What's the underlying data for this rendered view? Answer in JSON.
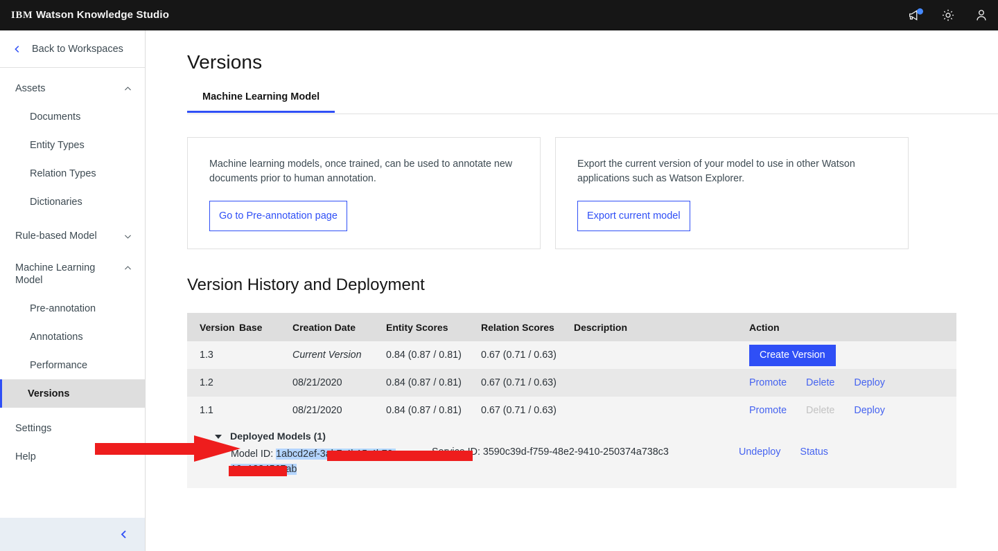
{
  "topbar": {
    "brand_ibm": "IBM",
    "brand_product": "Watson Knowledge Studio",
    "icons": [
      "announcement-icon",
      "gear-icon",
      "user-avatar-icon"
    ]
  },
  "sidebar": {
    "back_label": "Back to Workspaces",
    "groups": [
      {
        "label": "Assets",
        "expanded": true,
        "items": [
          "Documents",
          "Entity Types",
          "Relation Types",
          "Dictionaries"
        ]
      },
      {
        "label": "Rule-based Model",
        "expanded": false,
        "items": []
      },
      {
        "label": "Machine Learning Model",
        "expanded": true,
        "items": [
          "Pre-annotation",
          "Annotations",
          "Performance",
          "Versions"
        ]
      }
    ],
    "selected_item": "Versions",
    "flat_items": [
      "Settings",
      "Help"
    ],
    "collapse_label": "collapse-sidebar"
  },
  "main": {
    "title": "Versions",
    "tabs": [
      {
        "label": "Machine Learning Model",
        "active": true
      }
    ],
    "cards": [
      {
        "text": "Machine learning models, once trained, can be used to annotate new documents prior to human annotation.",
        "button": "Go to Pre-annotation page"
      },
      {
        "text": "Export the current version of your model to use in other Watson applications such as Watson Explorer.",
        "button": "Export current model"
      }
    ],
    "section_title": "Version History and Deployment",
    "table": {
      "columns": [
        "Version",
        "Base",
        "Creation Date",
        "Entity Scores",
        "Relation Scores",
        "Description",
        "Action"
      ],
      "rows": [
        {
          "version": "1.3",
          "base": "",
          "date": "Current Version",
          "date_italic": true,
          "entity": "0.84 (0.87 / 0.81)",
          "relation": "0.67 (0.71 / 0.63)",
          "description": "",
          "actions": [
            {
              "label": "Create Version",
              "type": "primary"
            }
          ]
        },
        {
          "version": "1.2",
          "base": "",
          "date": "08/21/2020",
          "date_italic": false,
          "entity": "0.84 (0.87 / 0.81)",
          "relation": "0.67 (0.71 / 0.63)",
          "description": "",
          "actions": [
            {
              "label": "Promote",
              "type": "link"
            },
            {
              "label": "Delete",
              "type": "link"
            },
            {
              "label": "Deploy",
              "type": "link"
            }
          ]
        },
        {
          "version": "1.1",
          "base": "",
          "date": "08/21/2020",
          "date_italic": false,
          "entity": "0.84 (0.87 / 0.81)",
          "relation": "0.67 (0.71 / 0.63)",
          "description": "",
          "actions": [
            {
              "label": "Promote",
              "type": "link"
            },
            {
              "label": "Delete",
              "type": "link-disabled"
            },
            {
              "label": "Deploy",
              "type": "link"
            }
          ]
        }
      ],
      "deployed": {
        "header": "Deployed Models (1)",
        "model_id_label": "Model ID:",
        "model_id_value": "1abcd2ef-3ab7-4b15-4b72-19a1234567ab",
        "model_id_redacted": true,
        "service_id_text": "Service ID: 3590c39d-f759-48e2-9410-250374a738c3",
        "actions": [
          "Undeploy",
          "Status"
        ]
      }
    }
  },
  "annotation": {
    "arrow_color": "#ee1d1d",
    "points_to": "Model ID value"
  },
  "colors": {
    "brand_blue": "#2f4ff6",
    "link_blue": "#4563f0",
    "topbar_bg": "#161616",
    "table_header_bg": "#dedede",
    "row_light": "#f4f4f4",
    "row_dark": "#e8e8e8",
    "redaction": "#ee1d1d",
    "selection_highlight": "#b4d5fe"
  }
}
